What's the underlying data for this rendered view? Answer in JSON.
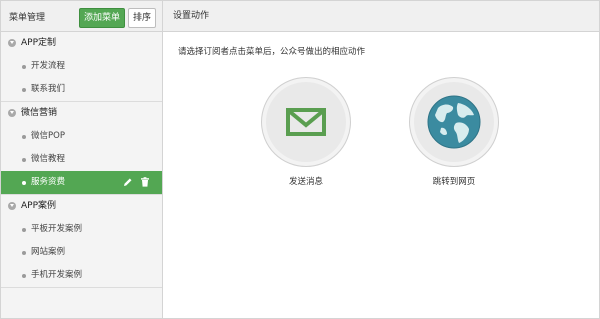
{
  "sidebar": {
    "title": "菜单管理",
    "add_button": "添加菜单",
    "sort_button": "排序",
    "groups": [
      {
        "label": "APP定制",
        "children": [
          "开发流程",
          "联系我们"
        ]
      },
      {
        "label": "微信营销",
        "children": [
          "微信POP",
          "微信教程",
          "服务资费"
        ]
      },
      {
        "label": "APP案例",
        "children": [
          "平板开发案例",
          "网站案例",
          "手机开发案例"
        ]
      }
    ],
    "active_item": "服务资费"
  },
  "main": {
    "title": "设置动作",
    "prompt": "请选择订阅者点击菜单后，公众号做出的相应动作",
    "actions": [
      {
        "label": "发送消息",
        "icon": "envelope-icon"
      },
      {
        "label": "跳转到网页",
        "icon": "globe-icon"
      }
    ]
  },
  "colors": {
    "accent": "#53a753",
    "panel": "#f0f0f0",
    "border": "#d4d4d4"
  }
}
